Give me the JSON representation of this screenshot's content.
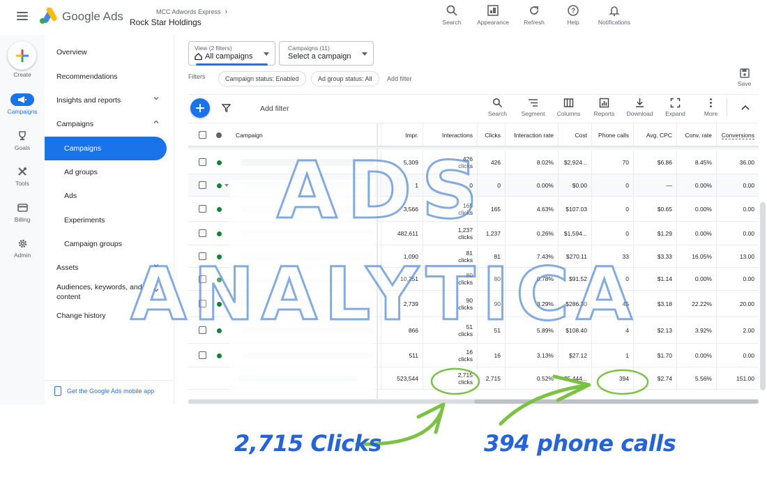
{
  "header": {
    "brand_google": "Google",
    "brand_ads": "Ads",
    "manager_account": "MCC Adwords Express",
    "account_name": "Rock Star Holdings",
    "tools": [
      {
        "label": "Search",
        "icon": "search-icon"
      },
      {
        "label": "Appearance",
        "icon": "appearance-icon"
      },
      {
        "label": "Refresh",
        "icon": "refresh-icon"
      },
      {
        "label": "Help",
        "icon": "help-icon"
      },
      {
        "label": "Notifications",
        "icon": "bell-icon"
      }
    ]
  },
  "rail": {
    "create_label": "Create",
    "items": [
      {
        "label": "Campaigns",
        "icon": "megaphone-icon",
        "active": true
      },
      {
        "label": "Goals",
        "icon": "trophy-icon"
      },
      {
        "label": "Tools",
        "icon": "tools-icon"
      },
      {
        "label": "Billing",
        "icon": "credit-card-icon"
      },
      {
        "label": "Admin",
        "icon": "gear-icon"
      }
    ]
  },
  "nav": {
    "items": [
      {
        "label": "Overview"
      },
      {
        "label": "Recommendations"
      },
      {
        "label": "Insights and reports"
      },
      {
        "label": "Campaigns"
      },
      {
        "label": "Campaigns"
      },
      {
        "label": "Ad groups"
      },
      {
        "label": "Ads"
      },
      {
        "label": "Experiments"
      },
      {
        "label": "Campaign groups"
      },
      {
        "label": "Assets"
      },
      {
        "label": "Audiences, keywords, and content"
      },
      {
        "label": "Change history"
      }
    ],
    "mobile_link": "Get the Google Ads mobile app"
  },
  "controls": {
    "view_top": "View (2 filters)",
    "view_main": "All campaigns",
    "campaigns_top": "Campaigns (11)",
    "campaigns_main": "Select a campaign",
    "filters_label": "Filters",
    "chips": [
      "Campaign status: Enabled",
      "Ad group status: All"
    ],
    "add_filter": "Add filter",
    "save_label": "Save"
  },
  "toolbar": {
    "add_filter": "Add filter",
    "tools": [
      {
        "label": "Search",
        "icon": "search-icon"
      },
      {
        "label": "Segment",
        "icon": "segment-icon"
      },
      {
        "label": "Columns",
        "icon": "columns-icon"
      },
      {
        "label": "Reports",
        "icon": "reports-icon"
      },
      {
        "label": "Download",
        "icon": "download-icon"
      },
      {
        "label": "Expand",
        "icon": "expand-icon"
      },
      {
        "label": "More",
        "icon": "more-vert-icon"
      }
    ]
  },
  "table": {
    "campaign_header": "Campaign",
    "columns": [
      "Impr.",
      "Interactions",
      "Clicks",
      "Interaction rate",
      "Cost",
      "Phone calls",
      "Avg. CPC",
      "Conv. rate",
      "Conversions"
    ],
    "rows": [
      {
        "impr": "5,309",
        "interactions": [
          "426",
          "clicks"
        ],
        "clicks": "426",
        "rate": "8.02%",
        "cost": "$2,924...",
        "calls": "70",
        "cpc": "$6.86",
        "conv_rate": "8.45%",
        "conv": "36.00"
      },
      {
        "impr": "1",
        "interactions": [
          "0",
          ""
        ],
        "clicks": "0",
        "rate": "0.00%",
        "cost": "$0.00",
        "calls": "0",
        "cpc": "—",
        "conv_rate": "0.00%",
        "conv": "0.00"
      },
      {
        "impr": "3,566",
        "interactions": [
          "165",
          "clicks"
        ],
        "clicks": "165",
        "rate": "4.63%",
        "cost": "$107.03",
        "calls": "0",
        "cpc": "$0.65",
        "conv_rate": "0.00%",
        "conv": "0.00"
      },
      {
        "impr": "482,611",
        "interactions": [
          "1,237",
          "clicks"
        ],
        "clicks": "1,237",
        "rate": "0.26%",
        "cost": "$1,594...",
        "calls": "0",
        "cpc": "$1.29",
        "conv_rate": "0.00%",
        "conv": "0.00"
      },
      {
        "impr": "1,090",
        "interactions": [
          "81",
          "clicks"
        ],
        "clicks": "81",
        "rate": "7.43%",
        "cost": "$270.11",
        "calls": "33",
        "cpc": "$3.33",
        "conv_rate": "16.05%",
        "conv": "13.00"
      },
      {
        "impr": "10,251",
        "interactions": [
          "80",
          "clicks"
        ],
        "clicks": "80",
        "rate": "0.78%",
        "cost": "$91.52",
        "calls": "0",
        "cpc": "$1.14",
        "conv_rate": "0.00%",
        "conv": "0.00"
      },
      {
        "impr": "2,739",
        "interactions": [
          "90",
          "clicks"
        ],
        "clicks": "90",
        "rate": "3.29%",
        "cost": "$286.30",
        "calls": "45",
        "cpc": "$3.18",
        "conv_rate": "22.22%",
        "conv": "20.00"
      },
      {
        "impr": "866",
        "interactions": [
          "51",
          "clicks"
        ],
        "clicks": "51",
        "rate": "5.89%",
        "cost": "$108.40",
        "calls": "4",
        "cpc": "$2.13",
        "conv_rate": "3.92%",
        "conv": "2.00"
      },
      {
        "impr": "511",
        "interactions": [
          "16",
          "clicks"
        ],
        "clicks": "16",
        "rate": "3.13%",
        "cost": "$27.12",
        "calls": "1",
        "cpc": "$1.70",
        "conv_rate": "0.00%",
        "conv": "0.00"
      }
    ],
    "total": {
      "impr": "523,544",
      "interactions": [
        "2,715",
        "clicks"
      ],
      "clicks": "2,715",
      "rate": "0.52%",
      "cost": "$5,444...",
      "calls": "394",
      "cpc": "$2.74",
      "conv_rate": "5.56%",
      "conv": "151.00"
    }
  },
  "watermark": {
    "line1": "ADS",
    "line2": "ANALYTICA"
  },
  "annotations": {
    "clicks": "2,715 Clicks",
    "calls": "394 phone calls"
  },
  "colors": {
    "accent": "#1a73e8",
    "status_green": "#188038",
    "highlight_green": "#7cc242",
    "annotation_blue": "#2563d8",
    "watermark_blue": "#5b8fd6"
  }
}
